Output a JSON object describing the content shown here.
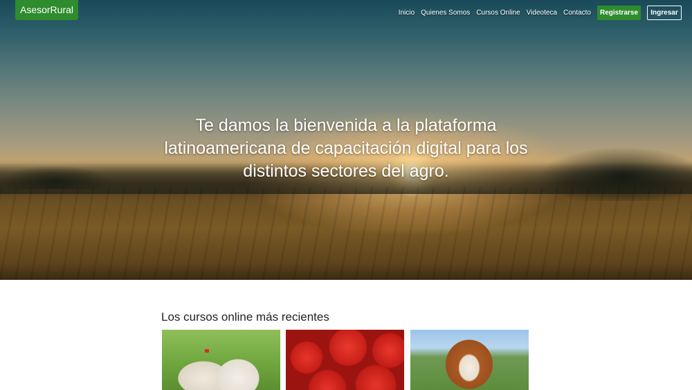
{
  "brand": {
    "name": "AsesorRural",
    "color": "#2e8b2e"
  },
  "nav": {
    "items": [
      {
        "label": "Inicio"
      },
      {
        "label": "Quienes Somos"
      },
      {
        "label": "Cursos Online"
      },
      {
        "label": "Videoteca"
      },
      {
        "label": "Contacto"
      }
    ],
    "register_label": "Registrarse",
    "login_label": "Ingresar"
  },
  "hero": {
    "title": "Te damos la bienvenida a la plataforma latinoamericana de capacitación digital para los distintos sectores del agro."
  },
  "courses": {
    "title": "Los cursos online más recientes",
    "cards": [
      {
        "image": "sheep-photo"
      },
      {
        "image": "tomatoes-photo"
      },
      {
        "image": "cow-photo"
      }
    ]
  }
}
